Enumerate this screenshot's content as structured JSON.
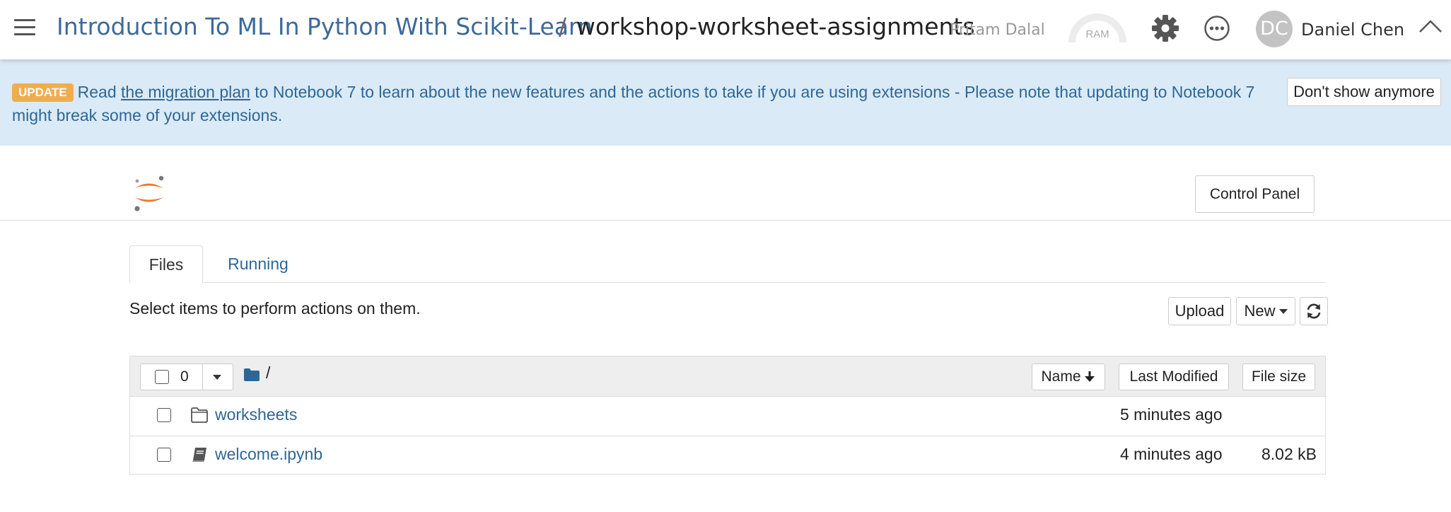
{
  "topbar": {
    "project": "Introduction To ML In Python With Scikit-Learn",
    "separator": "/",
    "repository": "workshop-worksheet-assignments",
    "owner": "Pritam Dalal",
    "ram_label": "RAM",
    "user_initials": "DC",
    "user_name": "Daniel Chen",
    "icons": [
      "menu-icon",
      "ram-gauge-icon",
      "gear-icon",
      "more-icon",
      "chevron-up-icon"
    ]
  },
  "banner": {
    "badge": "UPDATE",
    "text_before": "Read",
    "link_text": "the migration plan",
    "text_after": "to Notebook 7 to learn about the new features and the actions to take if you are using extensions - Please note that updating to Notebook 7 might break some of your extensions.",
    "dismiss_label": "Don't show anymore",
    "background_color": "#daeaf6",
    "badge_color": "#f0ad4e"
  },
  "header": {
    "logo": "jupyter-logo",
    "control_panel_label": "Control Panel"
  },
  "tabs": [
    {
      "label": "Files",
      "active": true
    },
    {
      "label": "Running",
      "active": false
    }
  ],
  "toolbar": {
    "hint": "Select items to perform actions on them.",
    "upload_label": "Upload",
    "new_label": "New",
    "refresh_icon": "refresh-icon"
  },
  "list": {
    "selected_count": "0",
    "path": "/",
    "columns": {
      "name": "Name",
      "modified": "Last Modified",
      "size": "File size"
    },
    "rows": [
      {
        "icon": "folder-icon",
        "name": "worksheets",
        "modified": "5 minutes ago",
        "size": ""
      },
      {
        "icon": "notebook-icon",
        "name": "welcome.ipynb",
        "modified": "4 minutes ago",
        "size": "8.02 kB"
      }
    ]
  },
  "colors": {
    "link": "#2e6795",
    "project_title": "#3d6a9a",
    "jupyter_orange": "#f37726"
  }
}
